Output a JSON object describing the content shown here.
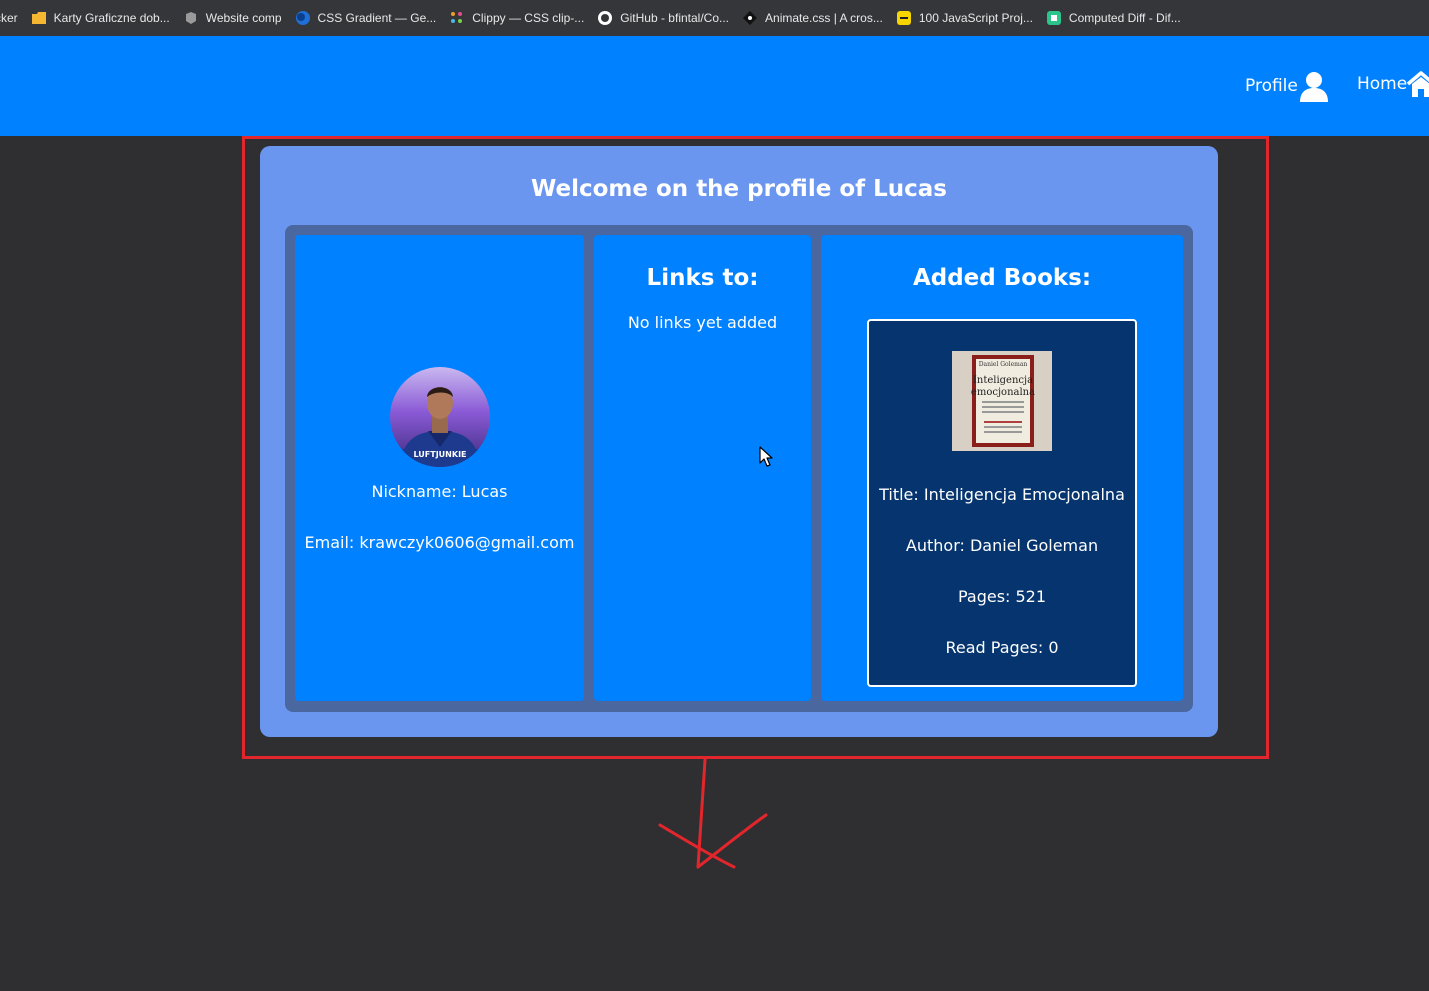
{
  "bookmarks": [
    {
      "label": "cker",
      "icon": "none",
      "color": ""
    },
    {
      "label": "Karty Graficzne dob...",
      "icon": "folder-icon",
      "color": "#f5b731"
    },
    {
      "label": "Website comp",
      "icon": "bookmark-app-icon",
      "color": "#b0b0b0"
    },
    {
      "label": "CSS Gradient — Ge...",
      "icon": "globe-icon",
      "color": "#1f6fd6"
    },
    {
      "label": "Clippy — CSS clip-...",
      "icon": "dots-icon",
      "color": "#e44d8b"
    },
    {
      "label": "GitHub - bfintal/Co...",
      "icon": "github-icon",
      "color": "#ffffff"
    },
    {
      "label": "Animate.css | A cros...",
      "icon": "animate-icon",
      "color": "#111111"
    },
    {
      "label": "100 JavaScript Proj...",
      "icon": "js-icon",
      "color": "#f7d600"
    },
    {
      "label": "Computed Diff - Dif...",
      "icon": "diff-icon",
      "color": "#2bc48a"
    }
  ],
  "nav": {
    "profile_label": "Profile",
    "home_label": "Home"
  },
  "profile": {
    "title": "Welcome on the profile of Lucas",
    "avatar_caption": "LUFTJUNKIE",
    "nickname": "Nickname: Lucas",
    "email": "Email: krawczyk0606@gmail.com"
  },
  "links": {
    "heading": "Links to:",
    "empty_text": "No links yet added"
  },
  "books": {
    "heading": "Added Books:",
    "items": [
      {
        "cover_author": "Daniel Goleman",
        "cover_title_line1": "Inteligencja",
        "cover_title_line2": "emocjonalna",
        "title": "Title: Inteligencja Emocjonalna",
        "author": "Author: Daniel Goleman",
        "pages": "Pages: 521",
        "read_pages": "Read Pages: 0"
      }
    ]
  },
  "colors": {
    "header": "#0081ff",
    "card": "#6a96f0",
    "panel": "#0081ff",
    "book_card": "#06346e",
    "annotation": "#e3262b",
    "background": "#2f2f31"
  }
}
